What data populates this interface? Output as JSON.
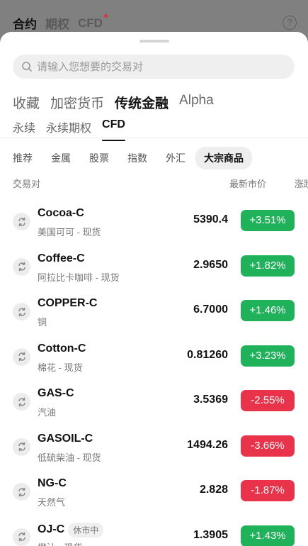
{
  "background": {
    "tabs": [
      "合约",
      "期权",
      "CFD"
    ],
    "help": "?"
  },
  "search": {
    "placeholder": "请输入您想要的交易对"
  },
  "category_tabs": [
    "收藏",
    "加密货币",
    "传统金融",
    "Alpha"
  ],
  "sub_tabs": [
    "永续",
    "永续期权",
    "CFD"
  ],
  "filters": [
    "推荐",
    "金属",
    "股票",
    "指数",
    "外汇",
    "大宗商品"
  ],
  "columns": {
    "pair": "交易对",
    "price": "最新市价",
    "change": "涨跌",
    "sort_icon": "÷"
  },
  "colors": {
    "up": "#20b25a",
    "down": "#e8334a"
  },
  "rows": [
    {
      "symbol": "Cocoa-C",
      "desc": "美国可可 - 现货",
      "price": "5390.4",
      "change": "+3.51%",
      "dir": "up"
    },
    {
      "symbol": "Coffee-C",
      "desc": "阿拉比卡咖啡 - 现货",
      "price": "2.9650",
      "change": "+1.82%",
      "dir": "up"
    },
    {
      "symbol": "COPPER-C",
      "desc": "铜",
      "price": "6.7000",
      "change": "+1.46%",
      "dir": "up"
    },
    {
      "symbol": "Cotton-C",
      "desc": "棉花 - 现货",
      "price": "0.81260",
      "change": "+3.23%",
      "dir": "up"
    },
    {
      "symbol": "GAS-C",
      "desc": "汽油",
      "price": "3.5369",
      "change": "-2.55%",
      "dir": "down"
    },
    {
      "symbol": "GASOIL-C",
      "desc": "低硫柴油 - 现货",
      "price": "1494.26",
      "change": "-3.66%",
      "dir": "down"
    },
    {
      "symbol": "NG-C",
      "desc": "天然气",
      "price": "2.828",
      "change": "-1.87%",
      "dir": "down"
    },
    {
      "symbol": "OJ-C",
      "tag": "休市中",
      "desc": "橙汁 - 现货",
      "price": "1.3905",
      "change": "+1.43%",
      "dir": "up"
    }
  ]
}
